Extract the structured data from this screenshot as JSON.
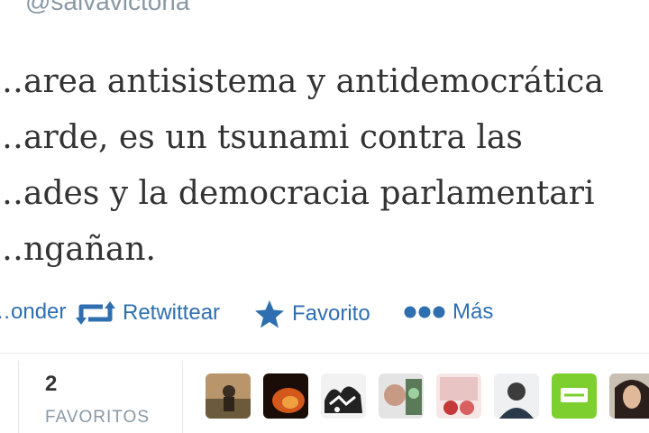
{
  "tweet": {
    "handle": "@salvavictoria",
    "lines": [
      "…area antisistema y antidemocrática",
      "…arde, es un tsunami contra las",
      "…ades y la democracia parlamentari",
      "…ngañan."
    ]
  },
  "actions": {
    "reply_label": "…onder",
    "retweet_label": "Retwittear",
    "favorite_label": "Favorito",
    "more_label": "Más",
    "accent_color": "#2f6fb0"
  },
  "stats": {
    "favorites_count": "2",
    "favorites_label": "FAVORITOS"
  },
  "avatars": [
    {
      "name": "avatar-1"
    },
    {
      "name": "avatar-2"
    },
    {
      "name": "avatar-3"
    },
    {
      "name": "avatar-4"
    },
    {
      "name": "avatar-5"
    },
    {
      "name": "avatar-6"
    },
    {
      "name": "avatar-7"
    },
    {
      "name": "avatar-8"
    }
  ]
}
